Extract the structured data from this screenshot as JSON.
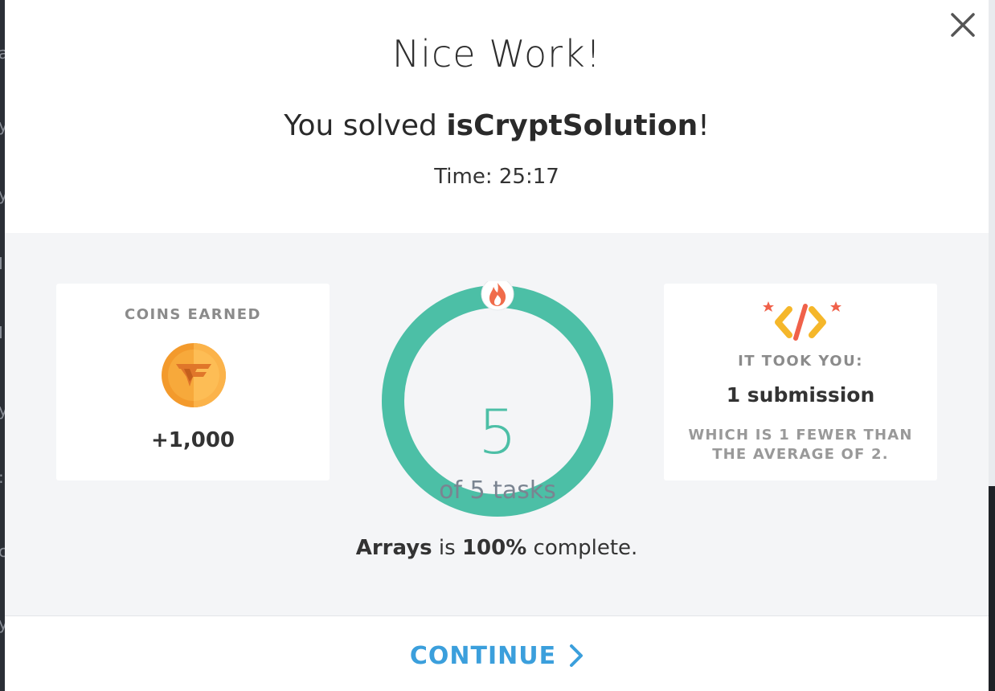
{
  "modal": {
    "title": "Nice Work!",
    "subtitle_prefix": "You solved ",
    "task_name": "isCryptSolution",
    "subtitle_suffix": "!",
    "time_label": "Time: 25:17"
  },
  "coins": {
    "label": "COINS EARNED",
    "value": "+1,000",
    "icon": "coin-icon"
  },
  "progress": {
    "completed": "5",
    "label": "of 5 tasks",
    "fraction": 1.0,
    "icon": "fire-icon",
    "color": "#4cbfa6"
  },
  "submissions": {
    "label": "IT TOOK YOU:",
    "value": "1 submission",
    "note": "WHICH IS 1 FEWER THAN THE AVERAGE OF 2.",
    "icon": "code-icon"
  },
  "completion": {
    "topic": "Arrays",
    "middle": " is ",
    "percent": "100%",
    "suffix": " complete."
  },
  "footer": {
    "continue_label": "CONTINUE",
    "accent_color": "#3b9fdc"
  },
  "background": {
    "fragments": [
      "a",
      "y",
      "y",
      "I",
      "I",
      "y",
      ":",
      "c",
      "y",
      "c"
    ]
  }
}
